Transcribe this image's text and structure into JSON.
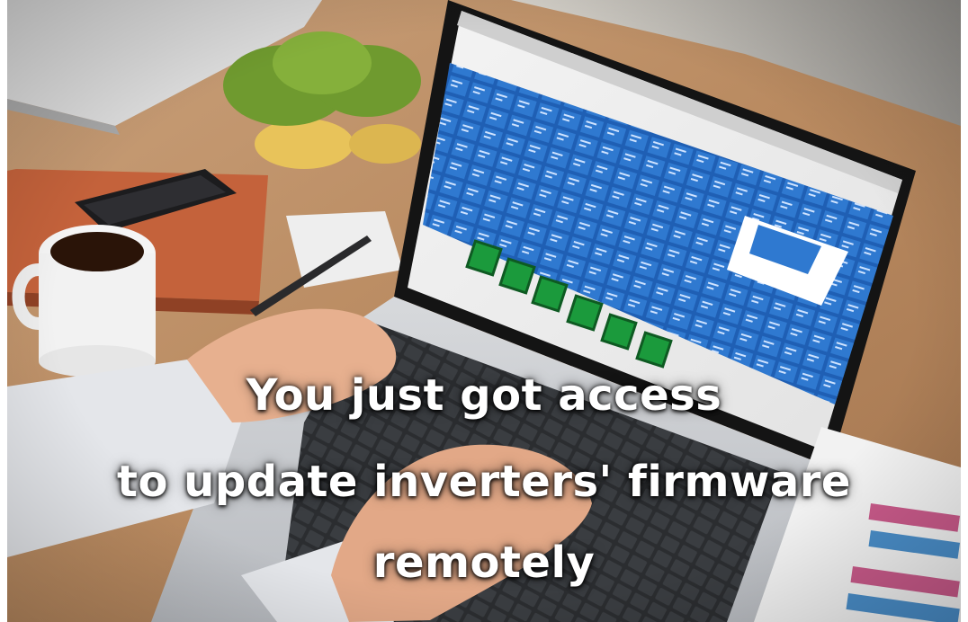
{
  "headline": {
    "line1": "You just got access",
    "line2": "to update inverters' firmware",
    "line3": "remotely"
  }
}
